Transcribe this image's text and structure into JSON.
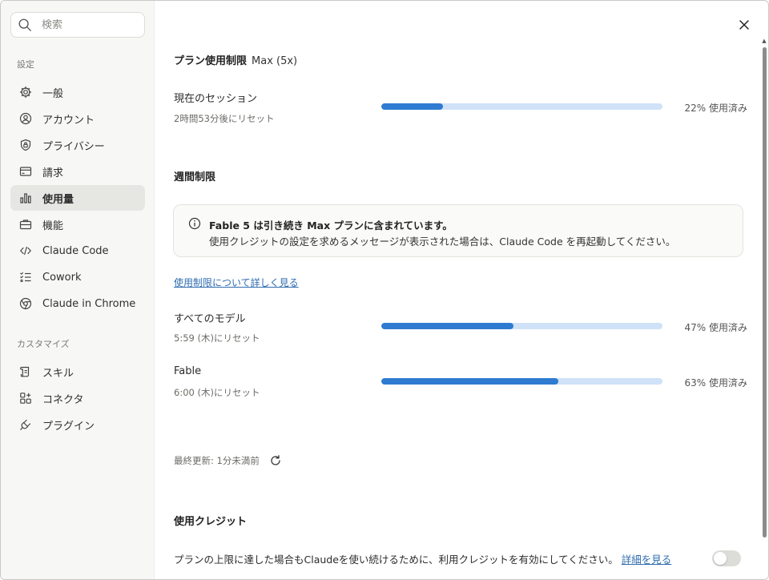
{
  "search": {
    "placeholder": "検索"
  },
  "sidebar": {
    "settings_label": "設定",
    "items": [
      {
        "label": "一般",
        "icon": "gear-icon"
      },
      {
        "label": "アカウント",
        "icon": "user-circle-icon"
      },
      {
        "label": "プライバシー",
        "icon": "shield-lock-icon"
      },
      {
        "label": "請求",
        "icon": "credit-card-icon"
      },
      {
        "label": "使用量",
        "icon": "bar-chart-icon",
        "active": true
      },
      {
        "label": "機能",
        "icon": "briefcase-icon"
      },
      {
        "label": "Claude Code",
        "icon": "code-icon"
      },
      {
        "label": "Cowork",
        "icon": "checklist-icon"
      },
      {
        "label": "Claude in Chrome",
        "icon": "globe-icon"
      }
    ],
    "customize_label": "カスタマイズ",
    "customize_items": [
      {
        "label": "スキル",
        "icon": "scroll-icon"
      },
      {
        "label": "コネクタ",
        "icon": "connector-icon"
      },
      {
        "label": "プラグイン",
        "icon": "plug-icon"
      }
    ]
  },
  "plan": {
    "heading": "プラン使用制限",
    "plan_name": "Max (5x)",
    "session": {
      "title": "現在のセッション",
      "reset": "2時間53分後にリセット",
      "percent": 22,
      "percent_label": "22% 使用済み"
    }
  },
  "weekly": {
    "heading": "週間制限",
    "info_title": "Fable 5 は引き続き Max プランに含まれています。",
    "info_body": "使用クレジットの設定を求めるメッセージが表示された場合は、Claude Code を再起動してください。",
    "learn_more": "使用制限について詳しく見る",
    "rows": [
      {
        "title": "すべてのモデル",
        "reset": "5:59 (木)にリセット",
        "percent": 47,
        "percent_label": "47% 使用済み"
      },
      {
        "title": "Fable",
        "reset": "6:00 (木)にリセット",
        "percent": 63,
        "percent_label": "63% 使用済み"
      }
    ]
  },
  "last_updated": "最終更新: 1分未満前",
  "credits": {
    "heading": "使用クレジット",
    "description": "プランの上限に達した場合もClaudeを使い続けるために、利用クレジットを有効にしてください。",
    "details_link": "詳細を見る",
    "enabled": false
  },
  "colors": {
    "progress_fill": "#2f7bd1",
    "progress_track": "#cfe2f7",
    "link": "#2f6db0",
    "active_nav": "#e6e6e3"
  }
}
